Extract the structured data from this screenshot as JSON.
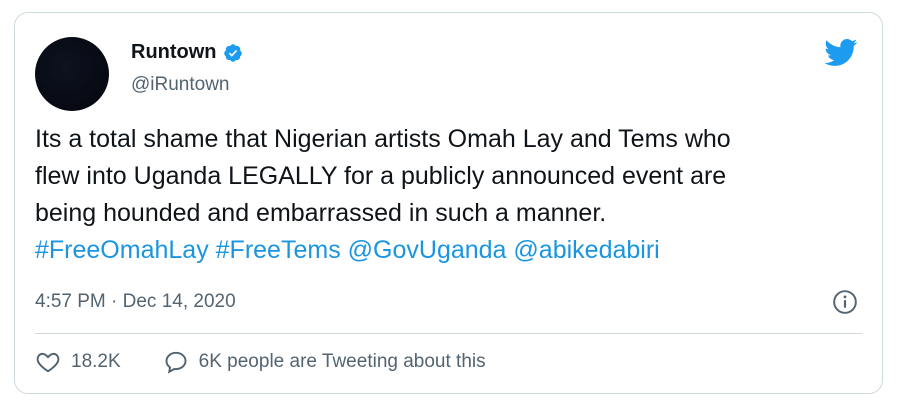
{
  "tweet": {
    "author_name": "Runtown",
    "author_handle": "@iRuntown",
    "text_lines": [
      "Its a total shame that Nigerian artists Omah Lay and Tems who",
      "flew into Uganda LEGALLY for a publicly announced event are",
      "being hounded and embarrassed in such a manner."
    ],
    "links": {
      "hashtag1": "#FreeOmahLay",
      "hashtag2": "#FreeTems",
      "mention1": "@GovUganda",
      "mention2": "@abikedabiri"
    },
    "timestamp": "4:57 PM · Dec 14, 2020",
    "likes": "18.2K",
    "tweeting_about": "6K people are Tweeting about this"
  },
  "colors": {
    "link": "#1b95e0",
    "verified": "#1d9bf0",
    "text_secondary": "#536471"
  },
  "icons": [
    "verified-badge-icon",
    "twitter-bird-icon",
    "info-icon",
    "heart-icon",
    "speech-bubble-icon"
  ]
}
